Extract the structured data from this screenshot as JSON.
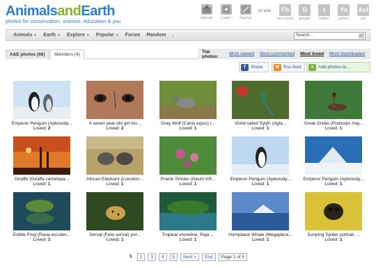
{
  "logo": {
    "part1": "Animals",
    "part2": "and",
    "part3": "Earth",
    "subtitle": "photos for conservation, science, education & you"
  },
  "toplinks": [
    {
      "label": "Upload",
      "icon": "upload-icon"
    },
    {
      "label": "Login",
      "icon": "login-icon"
    },
    {
      "label": "Signup",
      "icon": "signup-icon"
    }
  ],
  "or_use": "or use",
  "social": [
    {
      "abbr": "Fb",
      "label": "face book"
    },
    {
      "abbr": "G",
      "label": "google"
    },
    {
      "abbr": "t",
      "label": "twitter"
    },
    {
      "abbr": "Ya",
      "label": "yahoo"
    },
    {
      "abbr": "Aol",
      "label": "aol"
    }
  ],
  "nav": {
    "items": [
      "Animals",
      "Earth",
      "Explore",
      "Popular",
      "Forum",
      "Random",
      "."
    ],
    "search_value": "Search..."
  },
  "tabs": {
    "photos": "A&E photos (66)",
    "members": "Members (4)"
  },
  "top_photos": {
    "label": "Top photos:",
    "links": [
      "Most viewed",
      "Most commented",
      "Most loved",
      "Most downloaded"
    ]
  },
  "actions": {
    "share": "Share",
    "rss": "Rss feed",
    "add": "Add photos to..."
  },
  "photos": [
    {
      "caption": "Emperor Penguin (Aptenody...",
      "loved_label": "Loved:",
      "loved": "2"
    },
    {
      "caption": "A seven year old girl loo...",
      "loved_label": "Loved:",
      "loved": "2"
    },
    {
      "caption": "Gray Wolf (Canis lupus) r...",
      "loved_label": "Loved:",
      "loved": "1"
    },
    {
      "caption": "Violet-tailed Sylph (Agla...",
      "loved_label": "Loved:",
      "loved": "1"
    },
    {
      "caption": "Great Grebe (Podiceps maj...",
      "loved_label": "Loved:",
      "loved": "1"
    },
    {
      "caption": "Giraffe (Giraffa camelopa...",
      "loved_label": "Loved:",
      "loved": "1"
    },
    {
      "caption": "African Elephant (Loxodon...",
      "loved_label": "Loved:",
      "loved": "1"
    },
    {
      "caption": "Prairie Smoke (Geum trifl...",
      "loved_label": "Loved:",
      "loved": "1"
    },
    {
      "caption": "Emperor Penguin (Aptenody...",
      "loved_label": "Loved:",
      "loved": "1"
    },
    {
      "caption": "Emperor Penguin (Aptenody...",
      "loved_label": "Loved:",
      "loved": "1"
    },
    {
      "caption": "Edible Frog (Rana esculen...",
      "loved_label": "Loved:",
      "loved": "1"
    },
    {
      "caption": "Serval (Felis serval) por...",
      "loved_label": "Loved:",
      "loved": "1"
    },
    {
      "caption": "Tropical shoreline, Raja ...",
      "loved_label": "Loved:",
      "loved": "1"
    },
    {
      "caption": "Humpback Whale (Megaptera...",
      "loved_label": "Loved:",
      "loved": "1"
    },
    {
      "caption": "Jumping Spider portrait, ...",
      "loved_label": "Loved:",
      "loved": "1"
    }
  ],
  "pager": {
    "pages": [
      "1",
      "2",
      "3",
      "4",
      "5"
    ],
    "next": "Next >",
    "end": "End",
    "info": "Page 1 of 5"
  }
}
